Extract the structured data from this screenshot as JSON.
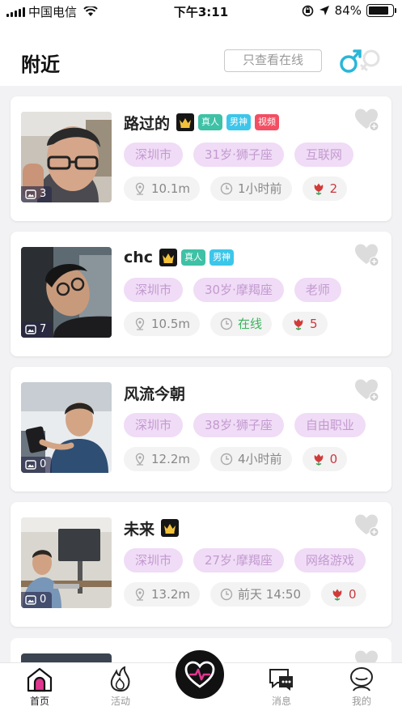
{
  "status_bar": {
    "carrier": "中国电信",
    "time": "下午3:11",
    "battery": "84%",
    "battery_level": 0.84
  },
  "header": {
    "title": "附近",
    "online_filter_label": "只查看在线"
  },
  "users": [
    {
      "name": "路过的",
      "vip": true,
      "badges": [
        {
          "label": "真人",
          "kind": "real"
        },
        {
          "label": "男神",
          "kind": "god"
        },
        {
          "label": "视频",
          "kind": "video"
        }
      ],
      "photo_count": "3",
      "city": "深圳市",
      "age_sign": "31岁·狮子座",
      "job": "互联网",
      "distance": "10.1m",
      "last_active": "1小时前",
      "roses": "2"
    },
    {
      "name": "chc",
      "vip": true,
      "badges": [
        {
          "label": "真人",
          "kind": "real"
        },
        {
          "label": "男神",
          "kind": "god"
        }
      ],
      "photo_count": "7",
      "city": "深圳市",
      "age_sign": "30岁·摩羯座",
      "job": "老师",
      "distance": "10.5m",
      "last_active": "在线",
      "roses": "5"
    },
    {
      "name": "风流今朝",
      "vip": false,
      "badges": [],
      "photo_count": "0",
      "city": "深圳市",
      "age_sign": "38岁·狮子座",
      "job": "自由职业",
      "distance": "12.2m",
      "last_active": "4小时前",
      "roses": "0"
    },
    {
      "name": "未来",
      "vip": true,
      "badges": [],
      "photo_count": "0",
      "city": "深圳市",
      "age_sign": "27岁·摩羯座",
      "job": "网络游戏",
      "distance": "13.2m",
      "last_active": "前天 14:50",
      "roses": "0"
    }
  ],
  "tabbar": {
    "home": "首页",
    "activity": "活动",
    "messages": "消息",
    "mine": "我的"
  },
  "colors": {
    "tag_bg": "#f0dcf6",
    "tag_text": "#c39ad0",
    "online": "#3bb45d",
    "rose": "#c8383f",
    "badge_real": "#3ec1a5",
    "badge_god": "#3cc6ea",
    "badge_video": "#f24f62",
    "gender_accent": "#29b6d8"
  }
}
